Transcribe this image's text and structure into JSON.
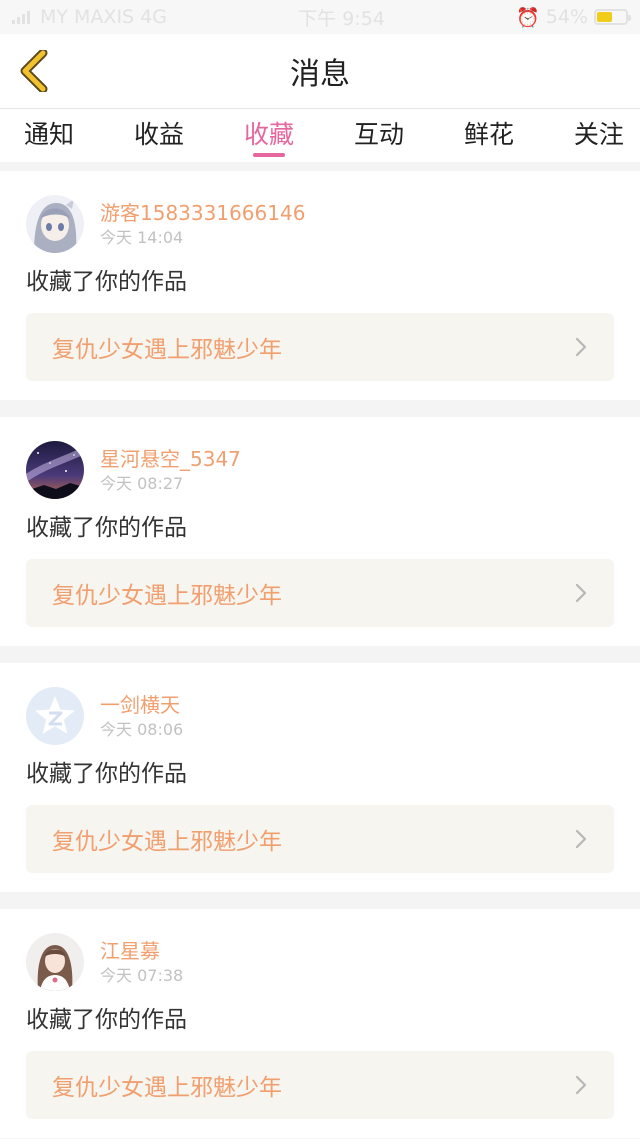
{
  "status_bar": {
    "carrier": "MY MAXIS 4G",
    "time": "下午 9:54",
    "battery": "54%",
    "battery_level": 0.54
  },
  "header": {
    "title": "消息",
    "back_icon": "chevron-left-icon"
  },
  "tabs": [
    {
      "label": "通知",
      "active": false
    },
    {
      "label": "收益",
      "active": false
    },
    {
      "label": "收藏",
      "active": true
    },
    {
      "label": "互动",
      "active": false
    },
    {
      "label": "鲜花",
      "active": false
    },
    {
      "label": "关注",
      "active": false
    }
  ],
  "messages": [
    {
      "user": "游客1583331666146",
      "time": "今天 14:04",
      "action": "收藏了你的作品",
      "work": "复仇少女遇上邪魅少年"
    },
    {
      "user": "星河悬空_5347",
      "time": "今天 08:27",
      "action": "收藏了你的作品",
      "work": "复仇少女遇上邪魅少年"
    },
    {
      "user": "一剑横天",
      "time": "今天 08:06",
      "action": "收藏了你的作品",
      "work": "复仇少女遇上邪魅少年"
    },
    {
      "user": "江星募",
      "time": "今天 07:38",
      "action": "收藏了你的作品",
      "work": "复仇少女遇上邪魅少年"
    }
  ],
  "colors": {
    "accent": "#e5679e",
    "name": "#f29f6f",
    "back": "#f2c12e"
  }
}
